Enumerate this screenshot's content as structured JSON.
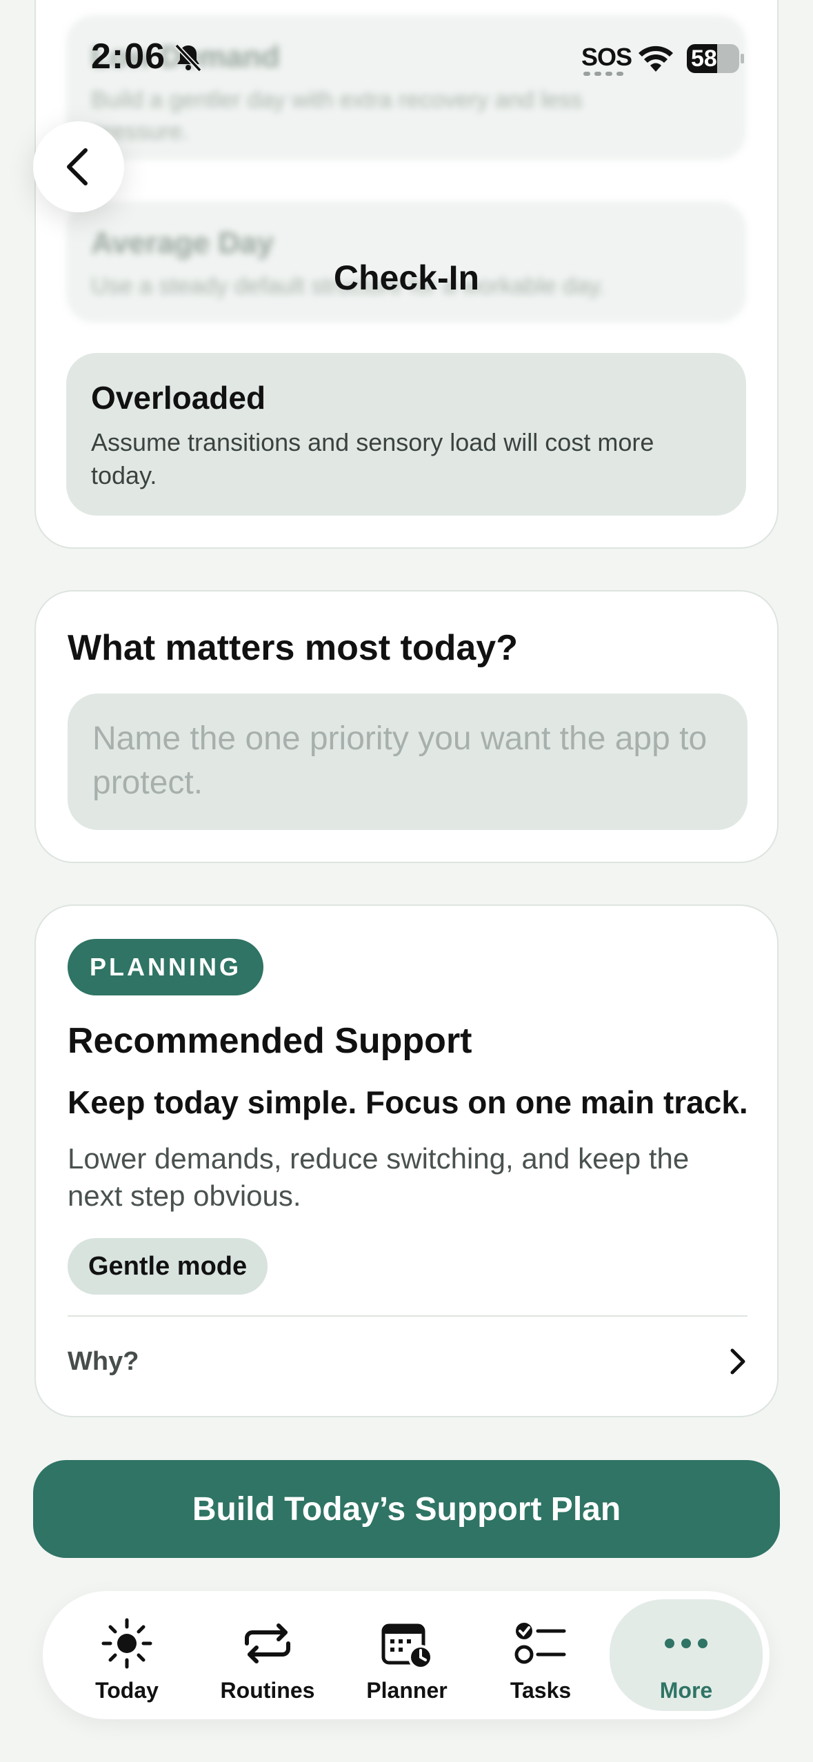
{
  "status_bar": {
    "time": "2:06",
    "sos": "SOS",
    "battery": "58"
  },
  "header": {
    "title": "Check-In",
    "back_icon": "chevron-left-icon"
  },
  "day_type": {
    "options": [
      {
        "title": "Low Demand",
        "description": "Build a gentler day with extra recovery and less pressure."
      },
      {
        "title": "Average Day",
        "description": "Use a steady default structure for a workable day."
      },
      {
        "title": "Overloaded",
        "description": "Assume transitions and sensory load will cost more today."
      }
    ],
    "selected": "Overloaded"
  },
  "priority": {
    "title": "What matters most today?",
    "placeholder": "Name the one priority you want the app to protect.",
    "value": ""
  },
  "recommendation": {
    "badge": "PLANNING",
    "title": "Recommended Support",
    "headline": "Keep today simple. Focus on one main track.",
    "description": "Lower demands, reduce switching, and keep the next step obvious.",
    "mode_chip": "Gentle mode",
    "why_label": "Why?"
  },
  "cta": {
    "label": "Build Today’s Support Plan"
  },
  "tab_bar": {
    "tabs": [
      {
        "label": "Today",
        "icon": "sun-icon"
      },
      {
        "label": "Routines",
        "icon": "repeat-icon"
      },
      {
        "label": "Planner",
        "icon": "calendar-clock-icon"
      },
      {
        "label": "Tasks",
        "icon": "checklist-icon"
      },
      {
        "label": "More",
        "icon": "ellipsis-icon"
      }
    ],
    "active": "More"
  },
  "colors": {
    "accent": "#2f7464",
    "background": "#f3f5f3",
    "selected_option": "#e1e8e4"
  }
}
